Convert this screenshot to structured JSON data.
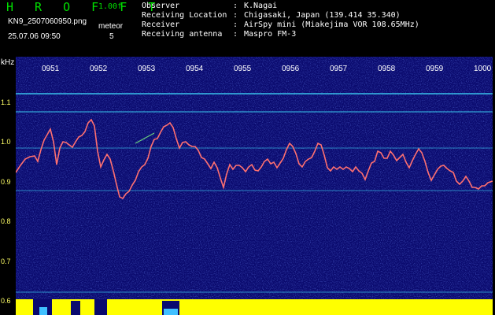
{
  "header": {
    "app_title": "H R O F F T",
    "version": "1.00f",
    "file_name": "KN9_2507060950.png",
    "timestamp": "25.07.06 09:50",
    "meteor_label": "meteor",
    "meteor_count": "5",
    "info": [
      {
        "key": "Observer",
        "value": "K.Nagai"
      },
      {
        "key": "Receiving Location",
        "value": "Chigasaki, Japan (139.414 35.340)"
      },
      {
        "key": "Receiver",
        "value": "AirSpy mini (Miakejima VOR 108.65MHz)"
      },
      {
        "key": "Receiving antenna",
        "value": "Maspro FM-3"
      }
    ]
  },
  "spectrogram": {
    "y_unit": "kHz",
    "y_ticks": [
      "1.1",
      "1.0",
      "0.9",
      "0.8",
      "0.7",
      "0.6"
    ],
    "x_ticks": [
      "0951",
      "0952",
      "0953",
      "0954",
      "0955",
      "0956",
      "0957",
      "0958",
      "0959",
      "1000"
    ],
    "colors": {
      "background": "#0a0a6e",
      "trace": "#ff7070",
      "carrier_lines": "#40e0ff",
      "tick_text": "#ffffff",
      "bottom_bar": "#ffff00",
      "bottom_dip": "#40c0ff"
    }
  }
}
